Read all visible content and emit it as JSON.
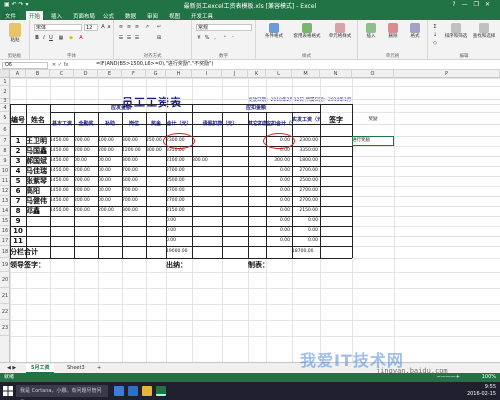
{
  "window": {
    "title": "最新员工excel工资表模板.xls [兼容模式] - Excel",
    "controls": [
      "?",
      "—",
      "❐",
      "✕"
    ]
  },
  "ribbon_tabs": [
    "文件",
    "开始",
    "插入",
    "页面布局",
    "公式",
    "数据",
    "审阅",
    "视图",
    "开发工具"
  ],
  "ribbon": {
    "paste": "粘贴",
    "font_name": "宋体",
    "font_size": "12",
    "number_format": "常规",
    "groups": [
      "剪贴板",
      "字体",
      "对齐方式",
      "数字",
      "样式",
      "单元格",
      "编辑"
    ],
    "buttons": [
      "条件格式",
      "套用表格格式",
      "单元格样式",
      "插入",
      "删除",
      "格式",
      "排序和筛选",
      "查找和选择"
    ]
  },
  "formula_bar": {
    "name_box": "O6",
    "fx": "fx",
    "formula": "=IF(AND(B5>1500,L6>=0),\"进行奖励\",\"不奖励\")"
  },
  "columns": [
    "A",
    "B",
    "C",
    "D",
    "E",
    "F",
    "G",
    "H",
    "I",
    "J",
    "K",
    "L",
    "M",
    "N",
    "O",
    "P"
  ],
  "rows": [
    "1",
    "2",
    "3",
    "4",
    "5",
    "6",
    "7",
    "8",
    "9",
    "10",
    "11",
    "12",
    "13",
    "14",
    "15",
    "16",
    "17",
    "18",
    "19",
    "20",
    "21",
    "22",
    "23"
  ],
  "sheet": {
    "title": "员工工资表",
    "subtitle": "发放日期：2018年2月12日   所属日期：2018年1月",
    "group_payable": "应发金额",
    "group_deduct": "应扣金额",
    "h_no": "编号",
    "h_name": "姓名",
    "h_base": "基本工资",
    "h_post": "全勤奖",
    "h_allow": "补助",
    "h_perf": "岗位",
    "h_bonus": "奖金",
    "h_total": "合计（元）",
    "h_leave": "请假扣款（元）",
    "h_other": "其它扣款（元）",
    "h_ded_total": "应扣合计（元）",
    "h_actual": "实发工资（元）",
    "h_sign": "签字",
    "h_reward": "奖励",
    "records": [
      {
        "no": "1",
        "name": "王卫明",
        "base": "1450.00",
        "post": "200.00",
        "allow": "100.00",
        "perf": "300.00",
        "bonus": "250.00",
        "total": "2300.00",
        "leave": "",
        "other": "",
        "ded": "0.00",
        "actual": "2300.00",
        "reward": "进行奖励"
      },
      {
        "no": "2",
        "name": "马国鑫",
        "base": "1450.00",
        "post": "200.00",
        "allow": "200.00",
        "perf": "1200.00",
        "bonus": "300.00",
        "total": "3350.00",
        "leave": "",
        "other": "",
        "ded": "0.00",
        "actual": "3350.00",
        "reward": ""
      },
      {
        "no": "3",
        "name": "郝国斌",
        "base": "1450.00",
        "post": "00.00",
        "allow": "00.00",
        "perf": "300.00",
        "bonus": "",
        "total": "2100.00",
        "leave": "300.00",
        "other": "",
        "ded": "300.00",
        "actual": "1800.00",
        "reward": ""
      },
      {
        "no": "4",
        "name": "马佳瑞",
        "base": "1450.00",
        "post": "200.00",
        "allow": "00.00",
        "perf": "700.00",
        "bonus": "",
        "total": "2700.00",
        "leave": "",
        "other": "",
        "ded": "0.00",
        "actual": "2700.00",
        "reward": ""
      },
      {
        "no": "5",
        "name": "张紫琴",
        "base": "1450.00",
        "post": "200.00",
        "allow": "00.00",
        "perf": "500.00",
        "bonus": "",
        "total": "2500.00",
        "leave": "",
        "other": "",
        "ded": "0.00",
        "actual": "2500.00",
        "reward": ""
      },
      {
        "no": "6",
        "name": "高阳",
        "base": "1450.00",
        "post": "200.00",
        "allow": "00.00",
        "perf": "700.00",
        "bonus": "",
        "total": "2700.00",
        "leave": "",
        "other": "",
        "ded": "0.00",
        "actual": "2700.00",
        "reward": ""
      },
      {
        "no": "7",
        "name": "马健伟",
        "base": "1450.00",
        "post": "200.00",
        "allow": "00.00",
        "perf": "700.00",
        "bonus": "",
        "total": "2700.00",
        "leave": "",
        "other": "",
        "ded": "0.00",
        "actual": "2700.00",
        "reward": ""
      },
      {
        "no": "8",
        "name": "邓鑫",
        "base": "1450.00",
        "post": "200.00",
        "allow": "200.00",
        "perf": "300.00",
        "bonus": "",
        "total": "2150.00",
        "leave": "",
        "other": "",
        "ded": "0.00",
        "actual": "2150.00",
        "reward": ""
      },
      {
        "no": "9",
        "name": "",
        "base": "",
        "post": "",
        "allow": "",
        "perf": "",
        "bonus": "",
        "total": "0.00",
        "leave": "",
        "other": "",
        "ded": "0.00",
        "actual": "0.00",
        "reward": ""
      },
      {
        "no": "10",
        "name": "",
        "base": "",
        "post": "",
        "allow": "",
        "perf": "",
        "bonus": "",
        "total": "0.00",
        "leave": "",
        "other": "",
        "ded": "0.00",
        "actual": "0.00",
        "reward": ""
      },
      {
        "no": "11",
        "name": "",
        "base": "",
        "post": "",
        "allow": "",
        "perf": "",
        "bonus": "",
        "total": "0.00",
        "leave": "",
        "other": "",
        "ded": "0.00",
        "actual": "0.00",
        "reward": ""
      }
    ],
    "subtotal_label": "分栏合计",
    "subtotal_total": "19000.00",
    "subtotal_actual": "18700.00",
    "footer_leader": "领导签字：",
    "footer_cashier": "出纳：",
    "footer_maker": "制表："
  },
  "sheet_tabs": [
    "5月工资",
    "Sheet3",
    "+"
  ],
  "status": {
    "ready": "就绪",
    "zoom": "100%"
  },
  "taskbar": {
    "search": "我是 Cortana，小娜。有问题尽管问我。",
    "time": "9:55",
    "date": "2016-02-15"
  },
  "watermark": {
    "brand": "我爱IT技术网",
    "url": "jingyan.baidu.com"
  },
  "colors": {
    "excel_green": "#217346",
    "header_blue": "#1a1a80",
    "highlight_red": "#e02020"
  }
}
